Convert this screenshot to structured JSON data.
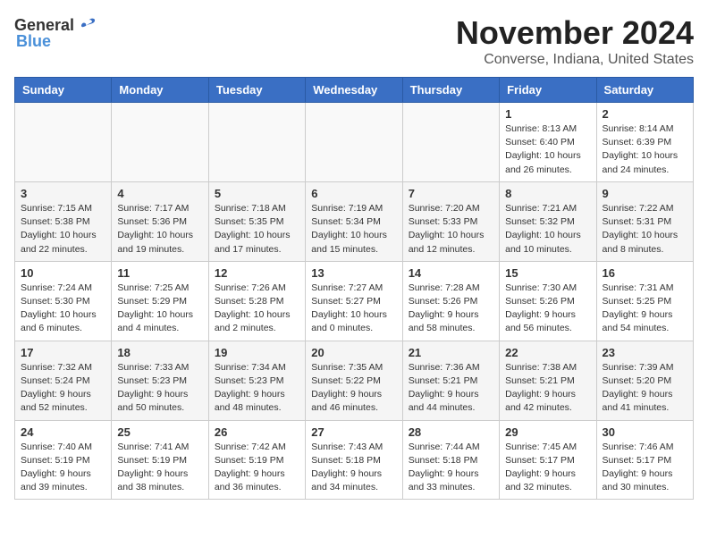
{
  "logo": {
    "general": "General",
    "blue": "Blue"
  },
  "title": "November 2024",
  "location": "Converse, Indiana, United States",
  "days_header": [
    "Sunday",
    "Monday",
    "Tuesday",
    "Wednesday",
    "Thursday",
    "Friday",
    "Saturday"
  ],
  "weeks": [
    [
      {
        "day": "",
        "info": ""
      },
      {
        "day": "",
        "info": ""
      },
      {
        "day": "",
        "info": ""
      },
      {
        "day": "",
        "info": ""
      },
      {
        "day": "",
        "info": ""
      },
      {
        "day": "1",
        "info": "Sunrise: 8:13 AM\nSunset: 6:40 PM\nDaylight: 10 hours and 26 minutes."
      },
      {
        "day": "2",
        "info": "Sunrise: 8:14 AM\nSunset: 6:39 PM\nDaylight: 10 hours and 24 minutes."
      }
    ],
    [
      {
        "day": "3",
        "info": "Sunrise: 7:15 AM\nSunset: 5:38 PM\nDaylight: 10 hours and 22 minutes."
      },
      {
        "day": "4",
        "info": "Sunrise: 7:17 AM\nSunset: 5:36 PM\nDaylight: 10 hours and 19 minutes."
      },
      {
        "day": "5",
        "info": "Sunrise: 7:18 AM\nSunset: 5:35 PM\nDaylight: 10 hours and 17 minutes."
      },
      {
        "day": "6",
        "info": "Sunrise: 7:19 AM\nSunset: 5:34 PM\nDaylight: 10 hours and 15 minutes."
      },
      {
        "day": "7",
        "info": "Sunrise: 7:20 AM\nSunset: 5:33 PM\nDaylight: 10 hours and 12 minutes."
      },
      {
        "day": "8",
        "info": "Sunrise: 7:21 AM\nSunset: 5:32 PM\nDaylight: 10 hours and 10 minutes."
      },
      {
        "day": "9",
        "info": "Sunrise: 7:22 AM\nSunset: 5:31 PM\nDaylight: 10 hours and 8 minutes."
      }
    ],
    [
      {
        "day": "10",
        "info": "Sunrise: 7:24 AM\nSunset: 5:30 PM\nDaylight: 10 hours and 6 minutes."
      },
      {
        "day": "11",
        "info": "Sunrise: 7:25 AM\nSunset: 5:29 PM\nDaylight: 10 hours and 4 minutes."
      },
      {
        "day": "12",
        "info": "Sunrise: 7:26 AM\nSunset: 5:28 PM\nDaylight: 10 hours and 2 minutes."
      },
      {
        "day": "13",
        "info": "Sunrise: 7:27 AM\nSunset: 5:27 PM\nDaylight: 10 hours and 0 minutes."
      },
      {
        "day": "14",
        "info": "Sunrise: 7:28 AM\nSunset: 5:26 PM\nDaylight: 9 hours and 58 minutes."
      },
      {
        "day": "15",
        "info": "Sunrise: 7:30 AM\nSunset: 5:26 PM\nDaylight: 9 hours and 56 minutes."
      },
      {
        "day": "16",
        "info": "Sunrise: 7:31 AM\nSunset: 5:25 PM\nDaylight: 9 hours and 54 minutes."
      }
    ],
    [
      {
        "day": "17",
        "info": "Sunrise: 7:32 AM\nSunset: 5:24 PM\nDaylight: 9 hours and 52 minutes."
      },
      {
        "day": "18",
        "info": "Sunrise: 7:33 AM\nSunset: 5:23 PM\nDaylight: 9 hours and 50 minutes."
      },
      {
        "day": "19",
        "info": "Sunrise: 7:34 AM\nSunset: 5:23 PM\nDaylight: 9 hours and 48 minutes."
      },
      {
        "day": "20",
        "info": "Sunrise: 7:35 AM\nSunset: 5:22 PM\nDaylight: 9 hours and 46 minutes."
      },
      {
        "day": "21",
        "info": "Sunrise: 7:36 AM\nSunset: 5:21 PM\nDaylight: 9 hours and 44 minutes."
      },
      {
        "day": "22",
        "info": "Sunrise: 7:38 AM\nSunset: 5:21 PM\nDaylight: 9 hours and 42 minutes."
      },
      {
        "day": "23",
        "info": "Sunrise: 7:39 AM\nSunset: 5:20 PM\nDaylight: 9 hours and 41 minutes."
      }
    ],
    [
      {
        "day": "24",
        "info": "Sunrise: 7:40 AM\nSunset: 5:19 PM\nDaylight: 9 hours and 39 minutes."
      },
      {
        "day": "25",
        "info": "Sunrise: 7:41 AM\nSunset: 5:19 PM\nDaylight: 9 hours and 38 minutes."
      },
      {
        "day": "26",
        "info": "Sunrise: 7:42 AM\nSunset: 5:19 PM\nDaylight: 9 hours and 36 minutes."
      },
      {
        "day": "27",
        "info": "Sunrise: 7:43 AM\nSunset: 5:18 PM\nDaylight: 9 hours and 34 minutes."
      },
      {
        "day": "28",
        "info": "Sunrise: 7:44 AM\nSunset: 5:18 PM\nDaylight: 9 hours and 33 minutes."
      },
      {
        "day": "29",
        "info": "Sunrise: 7:45 AM\nSunset: 5:17 PM\nDaylight: 9 hours and 32 minutes."
      },
      {
        "day": "30",
        "info": "Sunrise: 7:46 AM\nSunset: 5:17 PM\nDaylight: 9 hours and 30 minutes."
      }
    ]
  ]
}
